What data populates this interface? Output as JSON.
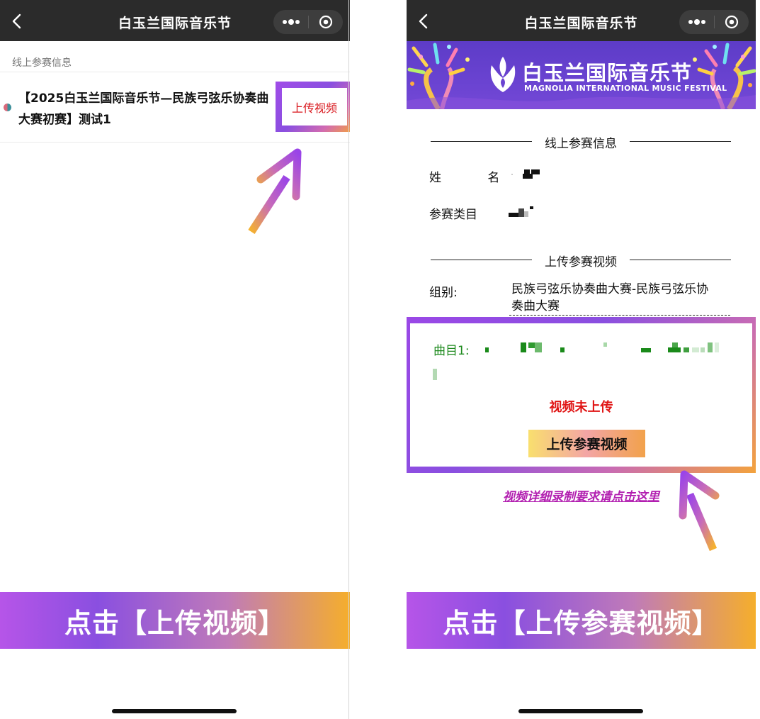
{
  "left_screen": {
    "nav_title": "白玉兰国际音乐节",
    "section_label": "线上参赛信息",
    "entry_title": "【2025白玉兰国际音乐节—民族弓弦乐协奏曲大赛初赛】测试1",
    "upload_link": "上传视频",
    "bottom_banner": "点击【上传视频】"
  },
  "right_screen": {
    "nav_title": "白玉兰国际音乐节",
    "banner_title_cn": "白玉兰国际音乐节",
    "banner_title_en": "MAGNOLIA INTERNATIONAL MUSIC FESTIVAL",
    "section_info": "线上参赛信息",
    "name_label": "姓 名",
    "category_label": "参赛类目",
    "section_upload": "上传参赛视频",
    "group_label": "组别:",
    "group_value": "民族弓弦乐协奏曲大赛-民族弓弦乐协奏曲大赛",
    "track_label": "曲目1:",
    "video_status": "视频未上传",
    "upload_button": "上传参赛视频",
    "detail_link": "视频详细录制要求请点击这里",
    "bottom_banner": "点击【上传参赛视频】"
  },
  "colors": {
    "navbar": "#2b2b2b",
    "link_red": "#d8151b",
    "status_red": "#e01414",
    "track_green": "#1e8a1e",
    "detail_link": "#b21fb0",
    "highlight_purple": "#8a4fe0",
    "highlight_orange": "#f4a43a"
  }
}
